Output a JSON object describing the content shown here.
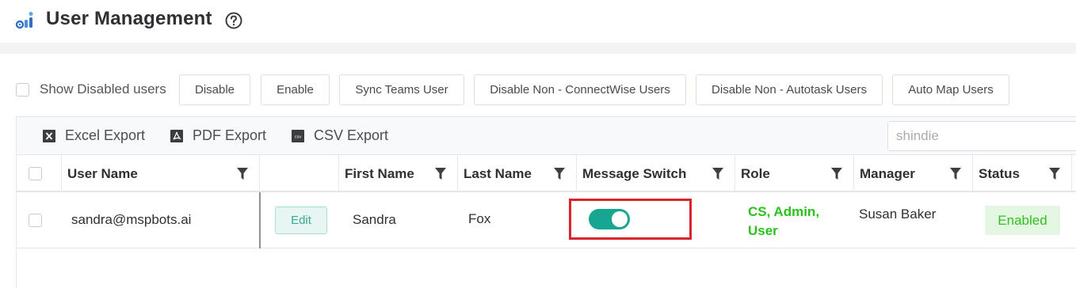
{
  "header": {
    "title": "User Management",
    "logo_icon": "gear-bars-logo-icon",
    "help_icon": "question-circle-icon"
  },
  "toolbar": {
    "show_disabled_label": "Show Disabled users",
    "show_disabled_checked": false,
    "buttons": [
      {
        "label": "Disable"
      },
      {
        "label": "Enable"
      },
      {
        "label": "Sync Teams User"
      },
      {
        "label": "Disable Non - ConnectWise Users"
      },
      {
        "label": "Disable Non - Autotask Users"
      },
      {
        "label": "Auto Map Users"
      }
    ]
  },
  "grid": {
    "exports": [
      {
        "label": "Excel Export",
        "icon": "excel-icon"
      },
      {
        "label": "PDF Export",
        "icon": "pdf-icon"
      },
      {
        "label": "CSV Export",
        "icon": "csv-icon"
      }
    ],
    "search_value": "shindie",
    "columns": [
      {
        "label": ""
      },
      {
        "label": "User Name"
      },
      {
        "label": ""
      },
      {
        "label": "First Name"
      },
      {
        "label": "Last Name"
      },
      {
        "label": "Message Switch"
      },
      {
        "label": "Role"
      },
      {
        "label": "Manager"
      },
      {
        "label": "Status"
      }
    ],
    "rows": [
      {
        "user_name": "sandra@mspbots.ai",
        "edit_label": "Edit",
        "first_name": "Sandra",
        "last_name": "Fox",
        "message_switch_on": true,
        "role": "CS, Admin, User",
        "manager": "Susan Baker",
        "status": "Enabled"
      }
    ]
  },
  "colors": {
    "accent": "#17a68f",
    "role_green": "#2ac11d",
    "status_green": "#2ec21c",
    "highlight_red": "#d9232d"
  }
}
